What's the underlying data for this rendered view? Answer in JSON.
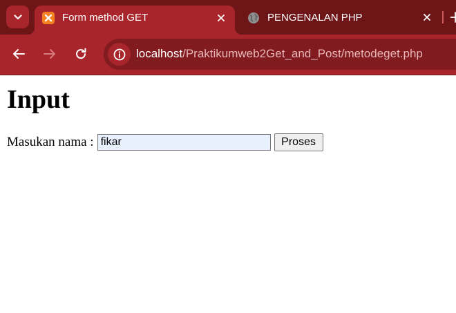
{
  "browser": {
    "tabs": [
      {
        "title": "Form method GET",
        "favicon": "xampp-icon",
        "active": true
      },
      {
        "title": "PENGENALAN PHP",
        "favicon": "globe-icon",
        "active": false
      }
    ],
    "address_bar": {
      "host": "localhost",
      "path": "/Praktikumweb2Get_and_Post/metodeget.php"
    },
    "colors": {
      "frame": "#6e1518",
      "toolbar": "#a8262b",
      "omnibox": "#811b1f",
      "xampp": "#f4801f"
    }
  },
  "page": {
    "heading": "Input",
    "form": {
      "label": "Masukan nama :",
      "name_value": "fikar",
      "submit_label": "Proses"
    }
  }
}
